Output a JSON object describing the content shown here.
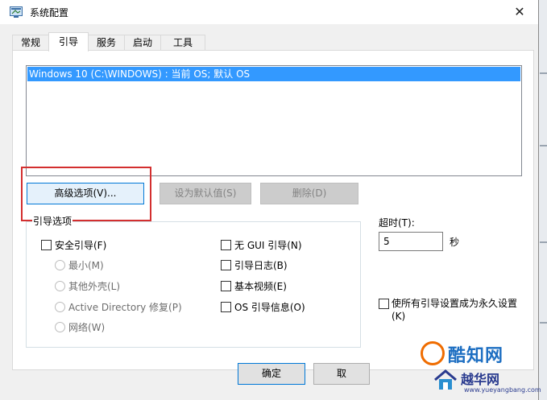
{
  "window": {
    "title": "系统配置",
    "close_glyph": "✕"
  },
  "tabs": [
    {
      "label": "常规",
      "active": false
    },
    {
      "label": "引导",
      "active": true
    },
    {
      "label": "服务",
      "active": false
    },
    {
      "label": "启动",
      "active": false
    },
    {
      "label": "工具",
      "active": false
    }
  ],
  "boot_list": {
    "items": [
      "Windows 10 (C:\\WINDOWS) : 当前 OS; 默认 OS"
    ],
    "selected_index": 0
  },
  "buttons": {
    "advanced": "高级选项(V)...",
    "set_default": "设为默认值(S)",
    "delete": "删除(D)",
    "ok": "确定",
    "cancel_partial": "取"
  },
  "boot_options": {
    "group_label": "引导选项",
    "safe_boot": {
      "label": "安全引导(F)",
      "checked": false
    },
    "safe_modes": [
      {
        "label": "最小(M)",
        "checked": false
      },
      {
        "label": "其他外壳(L)",
        "checked": false
      },
      {
        "label": "Active Directory 修复(P)",
        "checked": false
      },
      {
        "label": "网络(W)",
        "checked": false
      }
    ],
    "right_options": [
      {
        "label": "无 GUI 引导(N)",
        "checked": false
      },
      {
        "label": "引导日志(B)",
        "checked": false
      },
      {
        "label": "基本视频(E)",
        "checked": false
      },
      {
        "label": "OS 引导信息(O)",
        "checked": false
      }
    ]
  },
  "timeout": {
    "label": "超时(T):",
    "value": "5",
    "unit": "秒"
  },
  "permanent": {
    "label": "使所有引导设置成为永久设置(K)",
    "checked": false
  },
  "annotation": {
    "highlight_color": "#d32f2f"
  },
  "watermark": {
    "line1": "酷知网",
    "line2": "越华网",
    "line3": "www.yueyangbang.com"
  }
}
